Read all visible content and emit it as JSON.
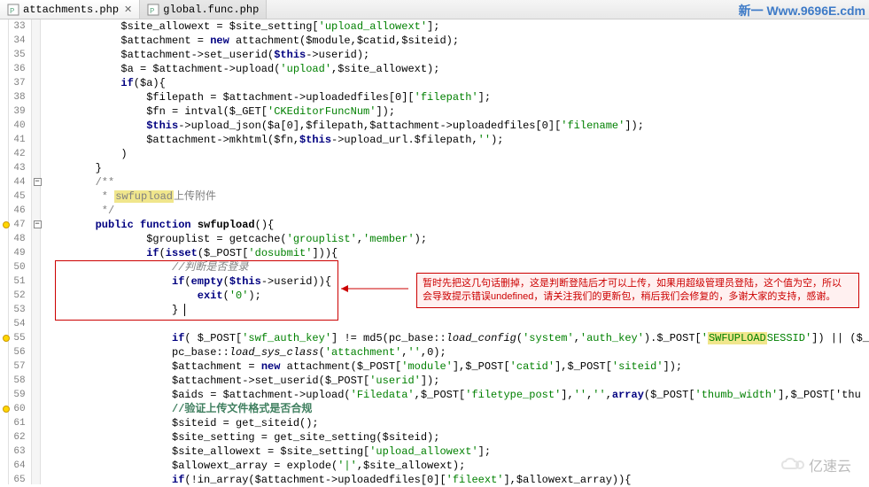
{
  "tabs": [
    {
      "label": "attachments.php",
      "active": true
    },
    {
      "label": "global.func.php",
      "active": false
    }
  ],
  "brand": "新一 Www.9696E.cdm",
  "lines": [
    {
      "n": 33,
      "html": "$site_allowext = $site_setting['upload_allowext'];",
      "indent": 3
    },
    {
      "n": 34,
      "html": "$attachment = <kw>new</kw> attachment($module,$catid,$siteid);",
      "indent": 3
    },
    {
      "n": 35,
      "html": "$attachment->set_userid(<kw>$this</kw>->userid);",
      "indent": 3
    },
    {
      "n": 36,
      "html": "$a = $attachment->upload('upload',$site_allowext);",
      "indent": 3
    },
    {
      "n": 37,
      "html": "<kw>if</kw>($a){",
      "indent": 3
    },
    {
      "n": 38,
      "html": "$filepath = $attachment->uploadedfiles[0]['filepath'];",
      "indent": 4
    },
    {
      "n": 39,
      "html": "$fn = intval($_GET['CKEditorFuncNum']);",
      "indent": 4
    },
    {
      "n": 40,
      "html": "<kw>$this</kw>->upload_json($a[0],$filepath,$attachment->uploadedfiles[0]['filename']);",
      "indent": 4
    },
    {
      "n": 41,
      "html": "$attachment->mkhtml($fn,<kw>$this</kw>->upload_url.$filepath,'');",
      "indent": 4
    },
    {
      "n": 42,
      "html": ")",
      "indent": 3
    },
    {
      "n": 43,
      "html": "}",
      "indent": 2
    },
    {
      "n": 44,
      "html": "<doccom>/**</doccom>",
      "indent": 2,
      "fold": "-"
    },
    {
      "n": 45,
      "html": "<doccom> * <hl>swfupload</hl>上传附件</doccom>",
      "indent": 2
    },
    {
      "n": 46,
      "html": "<doccom> */</doccom>",
      "indent": 2
    },
    {
      "n": 47,
      "html": "<kw>public function</kw> <method>swfupload</method>(){",
      "indent": 2,
      "fold": "-",
      "marker": true
    },
    {
      "n": 48,
      "html": "$grouplist = getcache('grouplist','member');",
      "indent": 4
    },
    {
      "n": 49,
      "html": "<kw>if</kw>(<kw>isset</kw>($_POST['dosubmit'])){",
      "indent": 4
    },
    {
      "n": 50,
      "html": "<com>//判断是否登录</com>",
      "indent": 5
    },
    {
      "n": 51,
      "html": "<kw>if</kw>(<kw>empty</kw>(<kw>$this</kw>->userid)){",
      "indent": 5
    },
    {
      "n": 52,
      "html": "<kw>exit</kw>('0');",
      "indent": 6
    },
    {
      "n": 53,
      "html": "} <cursor></cursor>",
      "indent": 5
    },
    {
      "n": 54,
      "html": "",
      "indent": 0
    },
    {
      "n": 55,
      "html": "<kw>if</kw>( $_POST['swf_auth_key'] != md5(pc_base::<i>load_config</i>('system','auth_key').$_POST['<hl>SWFUPLOAD</hl>SESSID']) || ($_",
      "indent": 5,
      "marker": true
    },
    {
      "n": 56,
      "html": "pc_base::<i>load_sys_class</i>('attachment','',0);",
      "indent": 5
    },
    {
      "n": 57,
      "html": "$attachment = <kw>new</kw> attachment($_POST['module'],$_POST['catid'],$_POST['siteid']);",
      "indent": 5
    },
    {
      "n": 58,
      "html": "$attachment->set_userid($_POST['userid']);",
      "indent": 5
    },
    {
      "n": 59,
      "html": "$aids = $attachment->upload('Filedata',$_POST['filetype_post'],'','',<kw>array</kw>($_POST['thumb_width'],$_POST['thu",
      "indent": 5
    },
    {
      "n": 60,
      "html": "<hlcom>//验证上传文件格式是否合规</hlcom>",
      "indent": 5,
      "marker": true
    },
    {
      "n": 61,
      "html": "$siteid = get_siteid();",
      "indent": 5
    },
    {
      "n": 62,
      "html": "$site_setting = get_site_setting($siteid);",
      "indent": 5
    },
    {
      "n": 63,
      "html": "$site_allowext = $site_setting['upload_allowext'];",
      "indent": 5
    },
    {
      "n": 64,
      "html": "$allowext_array = explode('|',$site_allowext);",
      "indent": 5
    },
    {
      "n": 65,
      "html": "<kw>if</kw>(!in_array($attachment->uploadedfiles[0]['fileext'],$allowext_array)){",
      "indent": 5
    }
  ],
  "annotation": {
    "text1": "暂时先把这几句话删掉，这是判断登陆后才可以上传，如果用超级管理员登陆，这个值为空，所以",
    "text2": "会导致提示错误undefined，请关注我们的更新包，稍后我们会修复的，多谢大家的支持，感谢。"
  },
  "watermark": "亿速云"
}
